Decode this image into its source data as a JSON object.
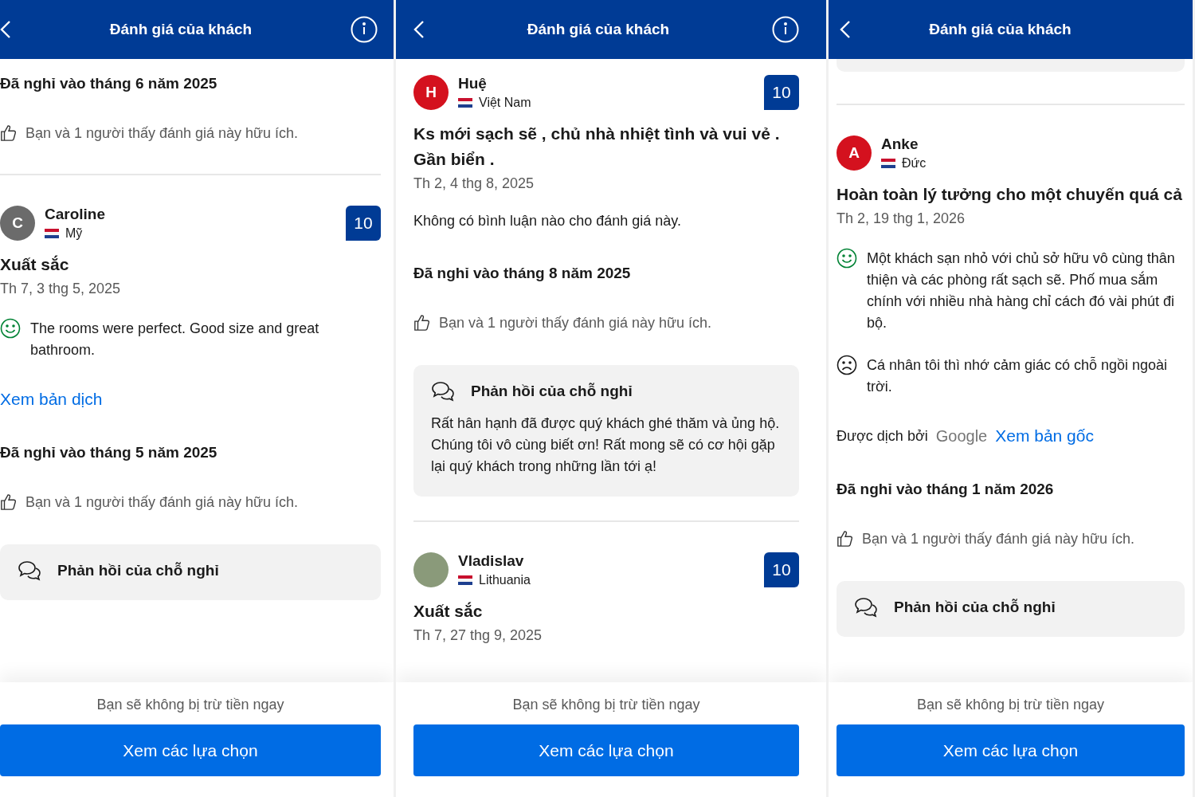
{
  "panels": [
    {
      "header": {
        "title": "Đánh giá của khách",
        "info_button": true
      },
      "items": [
        {
          "kind": "stay",
          "text": "Đã nghỉ vào tháng 6 năm 2025"
        },
        {
          "kind": "helpful",
          "text": "Bạn và 1 người thấy đánh giá này hữu ích."
        },
        {
          "kind": "divider"
        },
        {
          "kind": "reviewer",
          "letter": "C",
          "color": "#6b6b6b",
          "name": "Caroline",
          "country": "Mỹ",
          "score": "10"
        },
        {
          "kind": "title",
          "text": "Xuất sắc"
        },
        {
          "kind": "date",
          "text": "Th 7, 3 thg 5, 2025"
        },
        {
          "kind": "positive_comment",
          "text": "The rooms were perfect. Good size and great bathroom."
        },
        {
          "kind": "link",
          "text": "Xem bản dịch"
        },
        {
          "kind": "stay",
          "text": "Đã nghỉ vào tháng 5 năm 2025"
        },
        {
          "kind": "helpful",
          "text": "Bạn và 1 người thấy đánh giá này hữu ích."
        },
        {
          "kind": "response",
          "title": "Phản hồi của chỗ nghỉ"
        }
      ],
      "footer": {
        "note": "Bạn sẽ không bị trừ tiền ngay",
        "button": "Xem các lựa chọn"
      }
    },
    {
      "header": {
        "title": "Đánh giá của khách",
        "info_button": true
      },
      "items": [
        {
          "kind": "reviewer",
          "letter": "H",
          "color": "#d4111e",
          "name": "Huệ",
          "country": "Việt Nam",
          "score": "10"
        },
        {
          "kind": "title",
          "text": "Ks mới sạch sẽ , chủ nhà nhiệt tình và vui vẻ . Gần biển ."
        },
        {
          "kind": "date",
          "text": "Th 2, 4 thg 8, 2025"
        },
        {
          "kind": "plain",
          "text": "Không có bình luận nào cho đánh giá này."
        },
        {
          "kind": "stay",
          "text": "Đã nghỉ vào tháng 8 năm 2025"
        },
        {
          "kind": "helpful",
          "text": "Bạn và 1 người thấy đánh giá này hữu ích."
        },
        {
          "kind": "response",
          "title": "Phản hồi của chỗ nghỉ",
          "text": "Rất hân hạnh đã được quý khách ghé thăm và ủng hộ. Chúng tôi vô cùng biết ơn! Rất mong sẽ có cơ hội gặp lại quý khách trong những lần tới ạ!"
        },
        {
          "kind": "divider"
        },
        {
          "kind": "reviewer",
          "photo": true,
          "name": "Vladislav",
          "country": "Lithuania",
          "score": "10"
        },
        {
          "kind": "title",
          "text": "Xuất sắc"
        },
        {
          "kind": "date",
          "text": "Th 7, 27 thg 9, 2025"
        }
      ],
      "footer": {
        "note": "Bạn sẽ không bị trừ tiền ngay",
        "button": "Xem các lựa chọn"
      }
    },
    {
      "header": {
        "title": "Đánh giá của khách",
        "info_button": false
      },
      "items": [
        {
          "kind": "card_end"
        },
        {
          "kind": "divider"
        },
        {
          "kind": "reviewer",
          "letter": "A",
          "color": "#d4111e",
          "name": "Anke",
          "country": "Đức"
        },
        {
          "kind": "title",
          "text": "Hoàn toàn lý tưởng cho một chuyến quá cả"
        },
        {
          "kind": "date",
          "text": "Th 2, 19 thg 1, 2026"
        },
        {
          "kind": "positive_comment",
          "text": "Một khách sạn nhỏ với chủ sở hữu vô cùng thân thiện và các phòng rất sạch sẽ. Phố mua sắm chính với nhiều nhà hàng chỉ cách đó vài phút đi bộ."
        },
        {
          "kind": "negative_comment",
          "text": "Cá nhân tôi thì nhớ cảm giác có chỗ ngồi ngoài trời."
        },
        {
          "kind": "translated",
          "by": "Được dịch bởi",
          "brand": "Google",
          "link": "Xem bản gốc"
        },
        {
          "kind": "stay",
          "text": "Đã nghỉ vào tháng 1 năm 2026"
        },
        {
          "kind": "helpful",
          "text": "Bạn và 1 người thấy đánh giá này hữu ích."
        },
        {
          "kind": "response",
          "title": "Phản hồi của chỗ nghỉ"
        }
      ],
      "footer": {
        "note": "Bạn sẽ không bị trừ tiền ngay",
        "button": "Xem các lựa chọn"
      }
    }
  ]
}
